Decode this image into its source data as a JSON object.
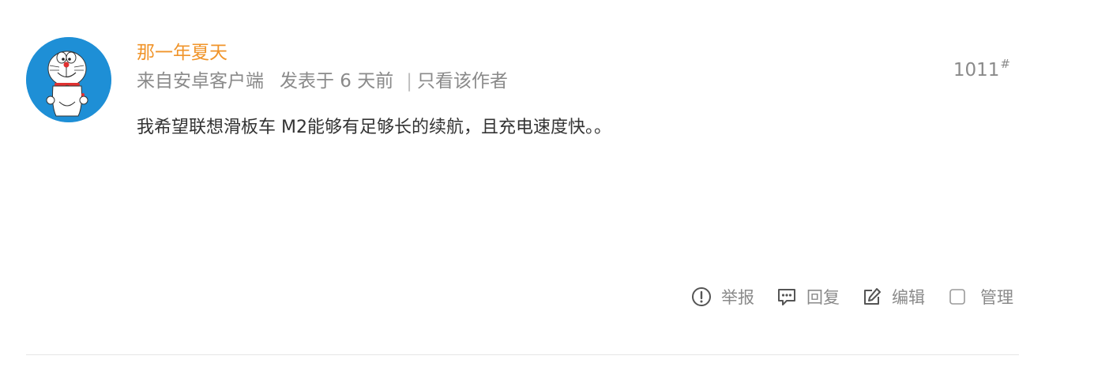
{
  "post": {
    "author": "那一年夏天",
    "source": "来自安卓客户端",
    "posted": "发表于 6 天前",
    "separator": "|",
    "only_author": "只看该作者",
    "floor_number": "1011",
    "floor_mark": "#",
    "content": "我希望联想滑板车 M2能够有足够长的续航，且充电速度快。。"
  },
  "actions": {
    "report": "举报",
    "reply": "回复",
    "edit": "编辑",
    "manage": "管理"
  },
  "icons": {
    "report": "exclamation-circle-icon",
    "reply": "comment-bubble-icon",
    "edit": "pencil-square-icon",
    "manage": "checkbox-icon"
  },
  "colors": {
    "author": "#f0942a",
    "meta": "#8a8a8a",
    "content": "#333333",
    "avatar_bg": "#1e8fd6"
  }
}
